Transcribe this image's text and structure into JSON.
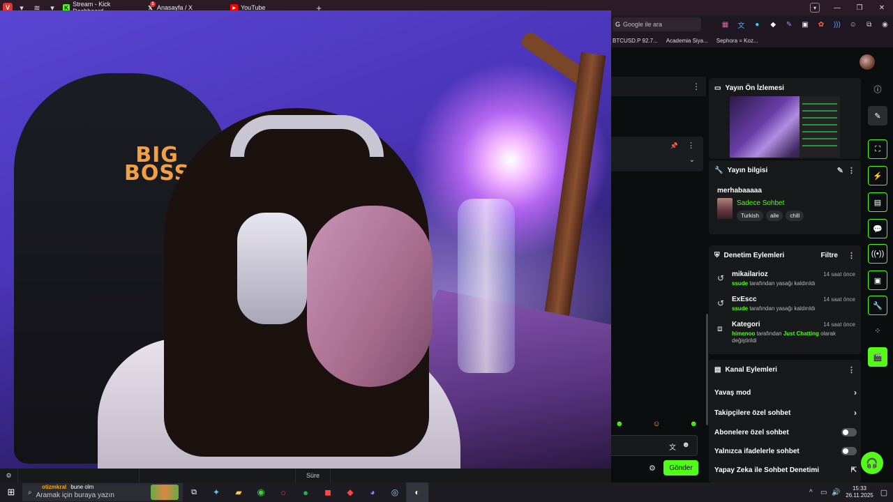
{
  "browser": {
    "tabs": [
      {
        "label": "Stream - Kick Dashboard",
        "favicon": "kick-icon",
        "color": "#53fc18"
      },
      {
        "label": "Anasayfa / X",
        "favicon": "x-icon",
        "badge": "1"
      },
      {
        "label": "YouTube",
        "favicon": "youtube-icon",
        "color": "#ff0000"
      }
    ],
    "new_tab_label": "+",
    "search_placeholder": "Google ile ara",
    "bookmarks": [
      "BTCUSD.P 92.7...",
      "Academia Siya...",
      "Sephora = Koz..."
    ]
  },
  "dashboard": {
    "preview_title": "Yayın Ön İzlemesi",
    "info_title": "Yayın bilgisi",
    "stream_title": "merhabaaaaa",
    "category": "Sadece Sohbet",
    "tags": [
      "Turkish",
      "aile",
      "chill"
    ],
    "mod_title": "Denetim Eylemleri",
    "mod_filter": "Filtre",
    "mod_actions": [
      {
        "user": "mikailarioz",
        "time": "14 saat önce",
        "actor": "ssude",
        "text": " tarafından yasağı kaldırıldı",
        "icon": "undo-icon"
      },
      {
        "user": "ExEscc",
        "time": "14 saat önce",
        "actor": "ssude",
        "text": " tarafından yasağı kaldırıldı",
        "icon": "undo-icon"
      },
      {
        "user": "Kategori",
        "time": "14 saat önce",
        "actor": "himenoo",
        "text": " tarafından ",
        "highlight": "Just Chatting",
        "text2": " olarak değiştirildi",
        "icon": "category-icon"
      }
    ],
    "channel_title": "Kanal Eylemleri",
    "channel_actions": [
      {
        "label": "Yavaş mod",
        "kind": "chevron"
      },
      {
        "label": "Takipçilere özel sohbet",
        "kind": "chevron"
      },
      {
        "label": "Abonelere özel sohbet",
        "kind": "toggle",
        "on": false
      },
      {
        "label": "Yalnızca ifadelerle sohbet",
        "kind": "toggle",
        "on": false
      },
      {
        "label": "Yapay Zeka ile Sohbet Denetimi",
        "kind": "external"
      }
    ],
    "send_label": "Gönder",
    "bottom_sure": "Süre",
    "accent": "#53fc18"
  },
  "taskbar": {
    "search_placeholder": "Aramak için buraya yazın",
    "notification_user": "otizmkral",
    "notification_text": "bune olm",
    "time": "15:33",
    "date": "26.11.2025"
  },
  "video": {
    "chair_text_line1": "BIG",
    "chair_text_line2": "BOSS"
  }
}
